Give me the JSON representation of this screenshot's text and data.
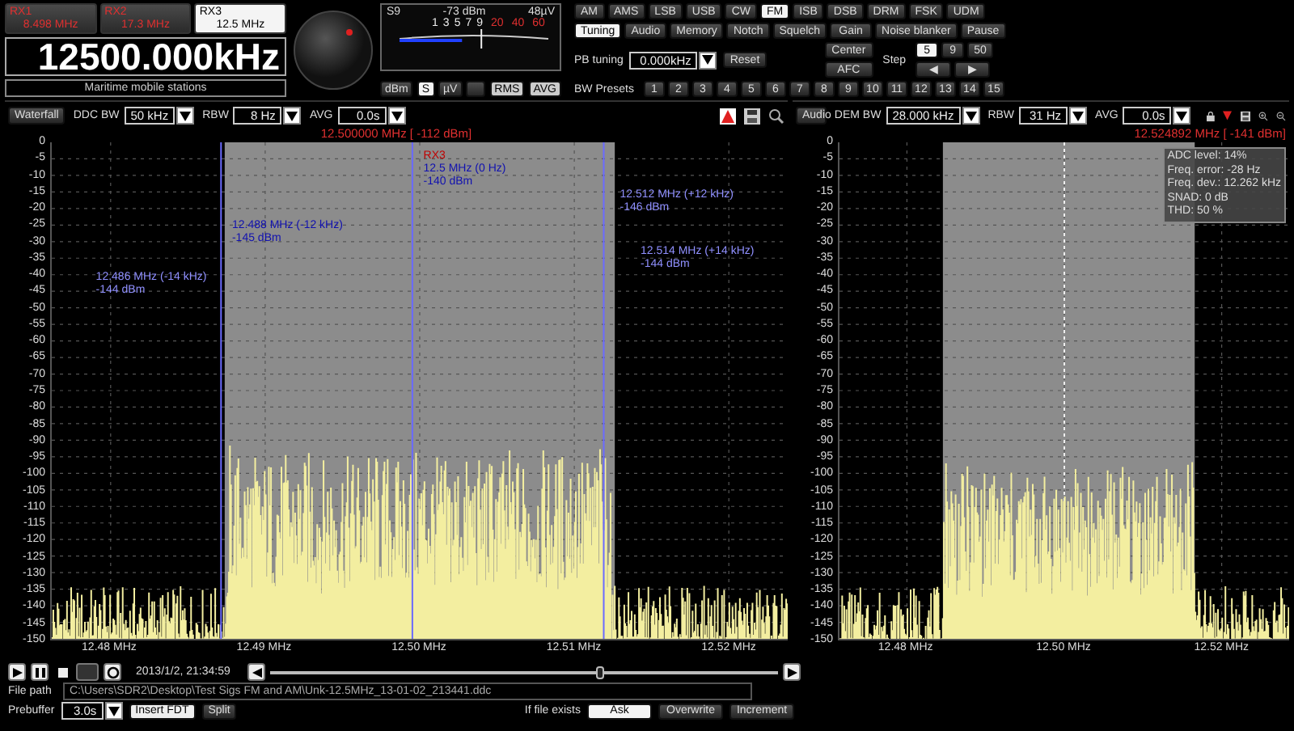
{
  "receivers": [
    {
      "name": "RX1",
      "frequency": "8.498 MHz",
      "selected": false
    },
    {
      "name": "RX2",
      "frequency": "17.3 MHz",
      "selected": false
    },
    {
      "name": "RX3",
      "frequency": "12.5 MHz",
      "selected": true
    }
  ],
  "frequency_display": "12500.000kHz",
  "band_label": "Maritime mobile stations",
  "s_meter": {
    "s_unit": "S9",
    "dbm": "-73 dBm",
    "microvolts": "48µV",
    "level": 0.42,
    "scale": [
      {
        "label": "1",
        "kind": "normal"
      },
      {
        "label": "3",
        "kind": "normal"
      },
      {
        "label": "5",
        "kind": "normal"
      },
      {
        "label": "7",
        "kind": "normal"
      },
      {
        "label": "9",
        "kind": "normal"
      },
      {
        "label": "20",
        "kind": "over"
      },
      {
        "label": "40",
        "kind": "over"
      },
      {
        "label": "60",
        "kind": "over"
      }
    ],
    "units": [
      {
        "label": "dBm",
        "selected": false
      },
      {
        "label": "S",
        "selected": true
      },
      {
        "label": "µV",
        "selected": false
      }
    ],
    "detectors": [
      {
        "label": "RMS",
        "selected": true
      },
      {
        "label": "AVG",
        "selected": true
      }
    ]
  },
  "modes": [
    {
      "label": "AM",
      "selected": false
    },
    {
      "label": "AMS",
      "selected": false
    },
    {
      "label": "LSB",
      "selected": false
    },
    {
      "label": "USB",
      "selected": false
    },
    {
      "label": "CW",
      "selected": false
    },
    {
      "label": "FM",
      "selected": true
    },
    {
      "label": "ISB",
      "selected": false
    },
    {
      "label": "DSB",
      "selected": false
    },
    {
      "label": "DRM",
      "selected": false
    },
    {
      "label": "FSK",
      "selected": false
    },
    {
      "label": "UDM",
      "selected": false
    }
  ],
  "tabs": [
    {
      "label": "Tuning",
      "selected": true
    },
    {
      "label": "Audio",
      "selected": false
    },
    {
      "label": "Memory",
      "selected": false
    },
    {
      "label": "Notch",
      "selected": false
    },
    {
      "label": "Squelch",
      "selected": false
    },
    {
      "label": "Gain",
      "selected": false
    },
    {
      "label": "Noise blanker",
      "selected": false
    },
    {
      "label": "Pause",
      "selected": false
    }
  ],
  "pb_tuning": {
    "label": "PB tuning",
    "value": "0.000kHz",
    "reset": "Reset"
  },
  "center": "Center",
  "afc": "AFC",
  "step": {
    "label": "Step",
    "options": [
      {
        "label": "5",
        "selected": true
      },
      {
        "label": "9",
        "selected": false
      },
      {
        "label": "50",
        "selected": false
      }
    ],
    "arrows": [
      "◀",
      "▶"
    ]
  },
  "bw_presets": {
    "label": "BW Presets",
    "items": [
      "1",
      "2",
      "3",
      "4",
      "5",
      "6",
      "7",
      "8",
      "9",
      "10",
      "11",
      "12",
      "13",
      "14",
      "15"
    ]
  },
  "spectrum": {
    "mode_button": "Waterfall",
    "fields": [
      {
        "label": "DDC BW",
        "value": "50 kHz"
      },
      {
        "label": "RBW",
        "value": "8 Hz"
      },
      {
        "label": "AVG",
        "value": "0.0s"
      }
    ],
    "readout": "12.500000 MHz [ -112 dBm]",
    "yticks": [
      "0",
      "-5",
      "-10",
      "-15",
      "-20",
      "-25",
      "-30",
      "-35",
      "-40",
      "-45",
      "-50",
      "-55",
      "-60",
      "-65",
      "-70",
      "-75",
      "-80",
      "-85",
      "-90",
      "-95",
      "-100",
      "-105",
      "-110",
      "-115",
      "-120",
      "-125",
      "-130",
      "-135",
      "-140",
      "-145",
      "-150"
    ],
    "xticks": [
      "12.48 MHz",
      "12.49 MHz",
      "12.50 MHz",
      "12.51 MHz",
      "12.52 MHz"
    ],
    "markers": [
      {
        "kind": "receiver",
        "lines": [
          "RX3",
          "12.5 MHz (0 Hz)",
          "-140 dBm"
        ]
      },
      {
        "kind": "marker",
        "lines": [
          "12.488 MHz (-12 kHz)",
          "-145 dBm"
        ]
      },
      {
        "kind": "marker",
        "lines": [
          "12.486 MHz (-14 kHz)",
          "-144 dBm"
        ]
      },
      {
        "kind": "marker",
        "lines": [
          "12.512 MHz (+12 kHz)",
          "-146 dBm"
        ]
      },
      {
        "kind": "marker",
        "lines": [
          "12.514 MHz (+14 kHz)",
          "-144 dBm"
        ]
      }
    ]
  },
  "audio_spectrum": {
    "mode_button": "Audio",
    "fields": [
      {
        "label": "DEM BW",
        "value": "28.000 kHz"
      },
      {
        "label": "RBW",
        "value": "31 Hz"
      },
      {
        "label": "AVG",
        "value": "0.0s"
      }
    ],
    "readout": "12.524892 MHz [ -141 dBm]",
    "yticks": [
      "0",
      "-5",
      "-10",
      "-15",
      "-20",
      "-25",
      "-30",
      "-35",
      "-40",
      "-45",
      "-50",
      "-55",
      "-60",
      "-65",
      "-70",
      "-75",
      "-80",
      "-85",
      "-90",
      "-95",
      "-100",
      "-105",
      "-110",
      "-115",
      "-120",
      "-125",
      "-130",
      "-135",
      "-140",
      "-145",
      "-150"
    ],
    "xticks": [
      "12.48 MHz",
      "12.50 MHz",
      "12.52 MHz"
    ],
    "info": [
      "ADC level: 14%",
      "Freq. error: -28 Hz",
      "Freq. dev.: 12.262 kHz",
      "SNAD: 0 dB",
      "THD: 50 %"
    ]
  },
  "player": {
    "timestamp": "2013/1/2, 21:34:59",
    "position": {
      "level": 0.65
    },
    "file_path": {
      "label": "File path",
      "value": "C:\\Users\\SDR2\\Desktop\\Test Sigs FM and AM\\Unk-12.5MHz_13-01-02_213441.ddc"
    },
    "prebuffer": {
      "label": "Prebuffer",
      "value": "3.0s"
    },
    "insert": "Insert FDT",
    "split": "Split",
    "if_file_exists": {
      "label": "If file exists",
      "options": [
        {
          "label": "Ask",
          "selected": true
        },
        {
          "label": "Overwrite",
          "selected": false
        },
        {
          "label": "Increment",
          "selected": false
        }
      ]
    }
  }
}
